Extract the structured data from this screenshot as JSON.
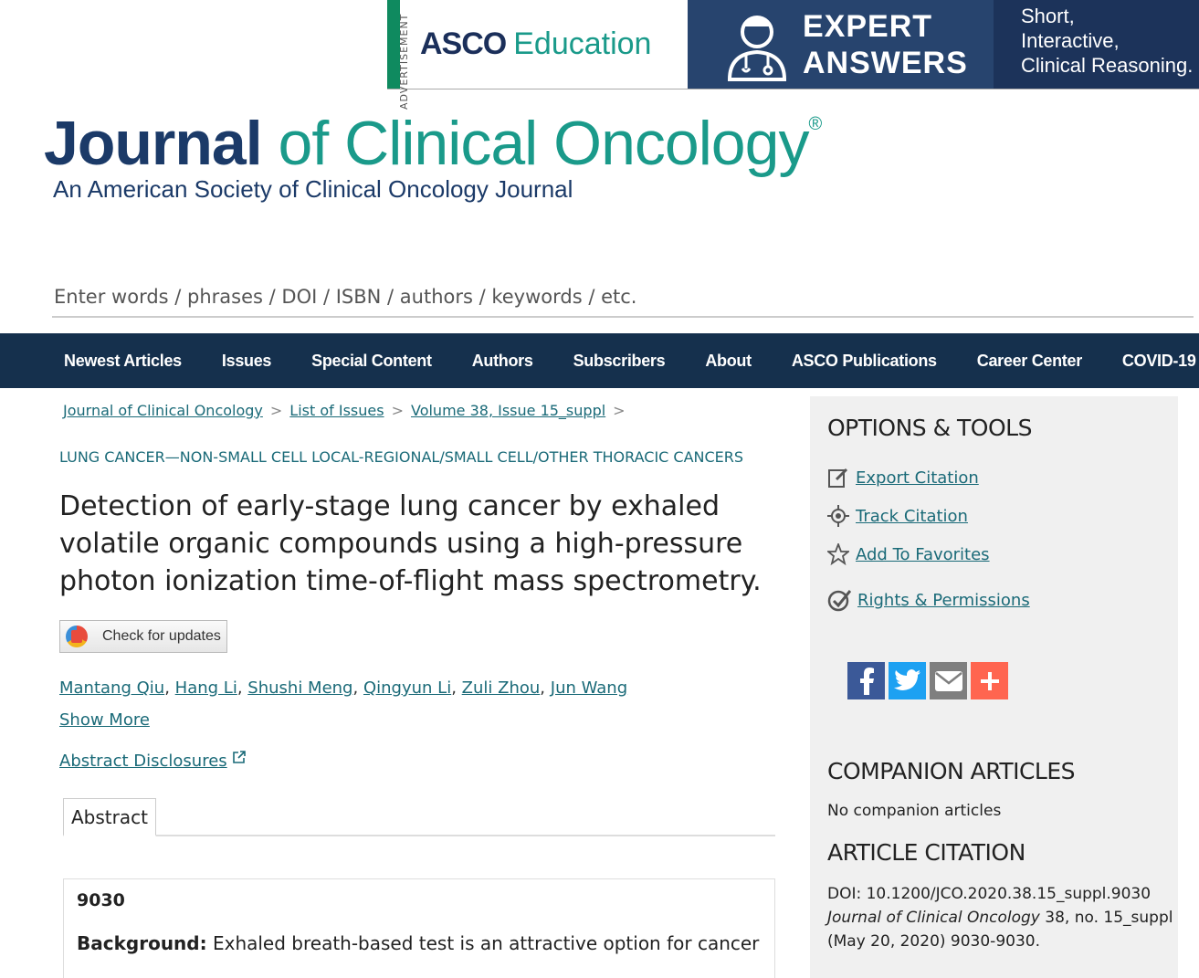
{
  "ad": {
    "label": "ADVERTISEMENT",
    "brand_bold": "ASCO",
    "brand_light": "Education",
    "headline_line1": "EXPERT",
    "headline_line2": "ANSWERS",
    "tagline_line1": "Short,",
    "tagline_line2": "Interactive,",
    "tagline_line3": "Clinical Reasoning.",
    "colors": {
      "strip": "#0f8a5f",
      "mid_bg": "#27446e",
      "right_bg": "#1c335a"
    }
  },
  "logo": {
    "word_journal": "Journal",
    "word_rest": " of Clinical Oncology",
    "registered": "®",
    "subtitle": "An American Society of Clinical Oncology Journal",
    "colors": {
      "navy": "#1b3a68",
      "teal": "#1a9a8a"
    }
  },
  "search": {
    "placeholder": "Enter words / phrases / DOI / ISBN / authors / keywords / etc."
  },
  "nav": {
    "items": [
      "Newest Articles",
      "Issues",
      "Special Content",
      "Authors",
      "Subscribers",
      "About",
      "ASCO Publications",
      "Career Center",
      "COVID-19"
    ],
    "bg": "#15304d"
  },
  "breadcrumb": {
    "items": [
      "Journal of Clinical Oncology",
      "List of Issues",
      "Volume 38, Issue 15_suppl"
    ],
    "separator": ">"
  },
  "article": {
    "section": "LUNG CANCER—NON-SMALL CELL LOCAL-REGIONAL/SMALL CELL/OTHER THORACIC CANCERS",
    "title": "Detection of early-stage lung cancer by exhaled volatile organic compounds using a high-pressure photon ionization time-of-flight mass spectrometry.",
    "check_updates": "Check for updates",
    "authors": [
      "Mantang Qiu",
      "Hang Li",
      "Shushi Meng",
      "Qingyun Li",
      "Zuli Zhou",
      "Jun Wang"
    ],
    "author_separator": ",",
    "show_more": "Show More",
    "disclosures": "Abstract Disclosures",
    "tab_abstract": "Abstract",
    "abstract_number": "9030",
    "background_label": "Background:",
    "background_text": "Exhaled breath-based test is an attractive option for cancer"
  },
  "sidebar": {
    "options_heading": "OPTIONS & TOOLS",
    "options": [
      {
        "label": "Export Citation",
        "icon": "edit-icon"
      },
      {
        "label": "Track Citation",
        "icon": "crosshair-icon"
      },
      {
        "label": "Add To Favorites",
        "icon": "star-icon"
      },
      {
        "label": "Rights & Permissions",
        "icon": "check-circle-icon"
      }
    ],
    "share": [
      {
        "icon": "facebook-icon",
        "glyph": "f",
        "color": "#3b5998"
      },
      {
        "icon": "twitter-icon",
        "glyph": "t",
        "color": "#1da1f2"
      },
      {
        "icon": "email-icon",
        "glyph": "✉",
        "color": "#7f7f7f"
      },
      {
        "icon": "plus-icon",
        "glyph": "+",
        "color": "#ff6550"
      }
    ],
    "companion_heading": "COMPANION ARTICLES",
    "companion_text": "No companion articles",
    "citation_heading": "ARTICLE CITATION",
    "citation_doi": "DOI: 10.1200/JCO.2020.38.15_suppl.9030",
    "citation_journal": "Journal of Clinical Oncology",
    "citation_rest": " 38, no. 15_suppl",
    "citation_date": "(May 20, 2020) 9030-9030."
  }
}
